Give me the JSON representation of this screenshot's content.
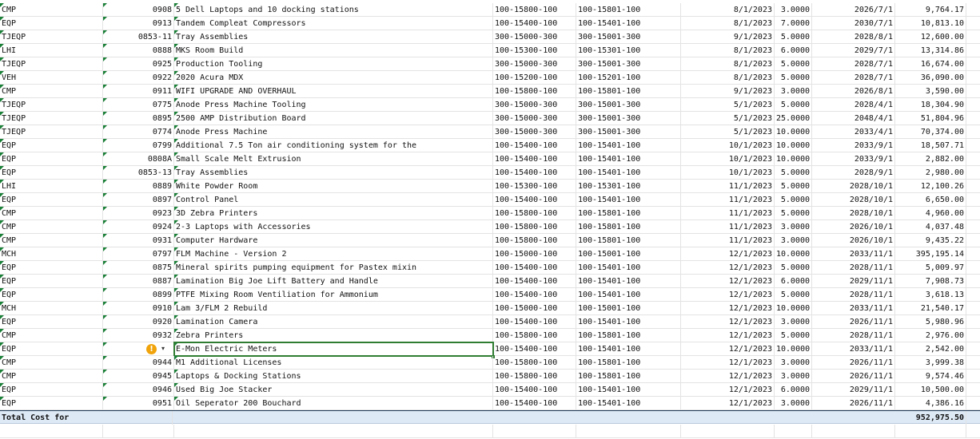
{
  "rows": [
    {
      "type": "CMP",
      "id": "0908",
      "desc": "5 Dell Laptops and 10 docking stations",
      "acct1": "100-15800-100",
      "acct2": "100-15801-100",
      "date": "8/1/2023",
      "qty": "3.0000",
      "end": "2026/7/1",
      "cost": "9,764.17"
    },
    {
      "type": "EQP",
      "id": "0913",
      "desc": "Tandem Compleat Compressors",
      "acct1": "100-15400-100",
      "acct2": "100-15401-100",
      "date": "8/1/2023",
      "qty": "7.0000",
      "end": "2030/7/1",
      "cost": "10,813.10"
    },
    {
      "type": "TJEQP",
      "id": "0853-11",
      "desc": "Tray Assemblies",
      "acct1": "300-15000-300",
      "acct2": "300-15001-300",
      "date": "9/1/2023",
      "qty": "5.0000",
      "end": "2028/8/1",
      "cost": "12,600.00"
    },
    {
      "type": "LHI",
      "id": "0888",
      "desc": "MKS Room Build",
      "acct1": "100-15300-100",
      "acct2": "100-15301-100",
      "date": "8/1/2023",
      "qty": "6.0000",
      "end": "2029/7/1",
      "cost": "13,314.86"
    },
    {
      "type": "TJEQP",
      "id": "0925",
      "desc": "Production Tooling",
      "acct1": "300-15000-300",
      "acct2": "300-15001-300",
      "date": "8/1/2023",
      "qty": "5.0000",
      "end": "2028/7/1",
      "cost": "16,674.00"
    },
    {
      "type": "VEH",
      "id": "0922",
      "desc": "2020 Acura MDX",
      "acct1": "100-15200-100",
      "acct2": "100-15201-100",
      "date": "8/1/2023",
      "qty": "5.0000",
      "end": "2028/7/1",
      "cost": "36,090.00"
    },
    {
      "type": "CMP",
      "id": "0911",
      "desc": "WIFI UPGRADE AND OVERHAUL",
      "acct1": "100-15800-100",
      "acct2": "100-15801-100",
      "date": "9/1/2023",
      "qty": "3.0000",
      "end": "2026/8/1",
      "cost": "3,590.00"
    },
    {
      "type": "TJEQP",
      "id": "0775",
      "desc": "Anode Press Machine Tooling",
      "acct1": "300-15000-300",
      "acct2": "300-15001-300",
      "date": "5/1/2023",
      "qty": "5.0000",
      "end": "2028/4/1",
      "cost": "18,304.90"
    },
    {
      "type": "TJEQP",
      "id": "0895",
      "desc": "2500 AMP Distribution Board",
      "acct1": "300-15000-300",
      "acct2": "300-15001-300",
      "date": "5/1/2023",
      "qty": "25.0000",
      "end": "2048/4/1",
      "cost": "51,804.96"
    },
    {
      "type": "TJEQP",
      "id": "0774",
      "desc": "Anode Press Machine",
      "acct1": "300-15000-300",
      "acct2": "300-15001-300",
      "date": "5/1/2023",
      "qty": "10.0000",
      "end": "2033/4/1",
      "cost": "70,374.00"
    },
    {
      "type": "EQP",
      "id": "0799",
      "desc": "Additional 7.5 Ton air conditioning system for the",
      "acct1": "100-15400-100",
      "acct2": "100-15401-100",
      "date": "10/1/2023",
      "qty": "10.0000",
      "end": "2033/9/1",
      "cost": "18,507.71"
    },
    {
      "type": "EQP",
      "id": "0808A",
      "desc": "Small Scale Melt Extrusion",
      "acct1": "100-15400-100",
      "acct2": "100-15401-100",
      "date": "10/1/2023",
      "qty": "10.0000",
      "end": "2033/9/1",
      "cost": "2,882.00"
    },
    {
      "type": "EQP",
      "id": "0853-13",
      "desc": "Tray Assemblies",
      "acct1": "100-15400-100",
      "acct2": "100-15401-100",
      "date": "10/1/2023",
      "qty": "5.0000",
      "end": "2028/9/1",
      "cost": "2,980.00"
    },
    {
      "type": "LHI",
      "id": "0889",
      "desc": "White Powder Room",
      "acct1": "100-15300-100",
      "acct2": "100-15301-100",
      "date": "11/1/2023",
      "qty": "5.0000",
      "end": "2028/10/1",
      "cost": "12,100.26"
    },
    {
      "type": "EQP",
      "id": "0897",
      "desc": "Control Panel",
      "acct1": "100-15400-100",
      "acct2": "100-15401-100",
      "date": "11/1/2023",
      "qty": "5.0000",
      "end": "2028/10/1",
      "cost": "6,650.00"
    },
    {
      "type": "CMP",
      "id": "0923",
      "desc": "3D Zebra Printers",
      "acct1": "100-15800-100",
      "acct2": "100-15801-100",
      "date": "11/1/2023",
      "qty": "5.0000",
      "end": "2028/10/1",
      "cost": "4,960.00"
    },
    {
      "type": "CMP",
      "id": "0924",
      "desc": "2-3 Laptops with Accessories",
      "acct1": "100-15800-100",
      "acct2": "100-15801-100",
      "date": "11/1/2023",
      "qty": "3.0000",
      "end": "2026/10/1",
      "cost": "4,037.48"
    },
    {
      "type": "CMP",
      "id": "0931",
      "desc": "Computer Hardware",
      "acct1": "100-15800-100",
      "acct2": "100-15801-100",
      "date": "11/1/2023",
      "qty": "3.0000",
      "end": "2026/10/1",
      "cost": "9,435.22"
    },
    {
      "type": "MCH",
      "id": "0797",
      "desc": "FLM Machine - Version 2",
      "acct1": "100-15000-100",
      "acct2": "100-15001-100",
      "date": "12/1/2023",
      "qty": "10.0000",
      "end": "2033/11/1",
      "cost": "395,195.14"
    },
    {
      "type": "EQP",
      "id": "0875",
      "desc": "Mineral spirits pumping equipment for Pastex mixin",
      "acct1": "100-15400-100",
      "acct2": "100-15401-100",
      "date": "12/1/2023",
      "qty": "5.0000",
      "end": "2028/11/1",
      "cost": "5,009.97"
    },
    {
      "type": "EQP",
      "id": "0887",
      "desc": "Lamination Big Joe Lift Battery and Handle",
      "acct1": "100-15400-100",
      "acct2": "100-15401-100",
      "date": "12/1/2023",
      "qty": "6.0000",
      "end": "2029/11/1",
      "cost": "7,908.73"
    },
    {
      "type": "EQP",
      "id": "0899",
      "desc": "PTFE Mixing Room Ventiliation for Ammonium",
      "acct1": "100-15400-100",
      "acct2": "100-15401-100",
      "date": "12/1/2023",
      "qty": "5.0000",
      "end": "2028/11/1",
      "cost": "3,618.13"
    },
    {
      "type": "MCH",
      "id": "0910",
      "desc": "Lam 3/FLM 2 Rebuild",
      "acct1": "100-15000-100",
      "acct2": "100-15001-100",
      "date": "12/1/2023",
      "qty": "10.0000",
      "end": "2033/11/1",
      "cost": "21,540.17"
    },
    {
      "type": "EQP",
      "id": "0920",
      "desc": "Lamination Camera",
      "acct1": "100-15400-100",
      "acct2": "100-15401-100",
      "date": "12/1/2023",
      "qty": "3.0000",
      "end": "2026/11/1",
      "cost": "5,980.96"
    },
    {
      "type": "CMP",
      "id": "0932",
      "desc": "Zebra Printers",
      "acct1": "100-15800-100",
      "acct2": "100-15801-100",
      "date": "12/1/2023",
      "qty": "5.0000",
      "end": "2028/11/1",
      "cost": "2,976.00"
    },
    {
      "type": "EQP",
      "id": "",
      "desc": "E-Mon Electric Meters",
      "acct1": "100-15400-100",
      "acct2": "100-15401-100",
      "date": "12/1/2023",
      "qty": "10.0000",
      "end": "2033/11/1",
      "cost": "2,542.00",
      "selected": true
    },
    {
      "type": "CMP",
      "id": "0944",
      "desc": "M1 Additional Licenses",
      "acct1": "100-15800-100",
      "acct2": "100-15801-100",
      "date": "12/1/2023",
      "qty": "3.0000",
      "end": "2026/11/1",
      "cost": "3,999.38"
    },
    {
      "type": "CMP",
      "id": "0945",
      "desc": "Laptops & Docking Stations",
      "acct1": "100-15800-100",
      "acct2": "100-15801-100",
      "date": "12/1/2023",
      "qty": "3.0000",
      "end": "2026/11/1",
      "cost": "9,574.46"
    },
    {
      "type": "EQP",
      "id": "0946",
      "desc": "Used Big Joe Stacker",
      "acct1": "100-15400-100",
      "acct2": "100-15401-100",
      "date": "12/1/2023",
      "qty": "6.0000",
      "end": "2029/11/1",
      "cost": "10,500.00"
    },
    {
      "type": "EQP",
      "id": "0951",
      "desc": "Oil Seperator 200 Bouchard",
      "acct1": "100-15400-100",
      "acct2": "100-15401-100",
      "date": "12/1/2023",
      "qty": "3.0000",
      "end": "2026/11/1",
      "cost": "4,386.16"
    }
  ],
  "total": {
    "label": "Total Cost for",
    "value": "952,975.50"
  },
  "warning_icon": "warning-icon",
  "dropdown_icon": "chevron-down-icon",
  "accent": "#2f7d32",
  "total_bg": "#dde9f5"
}
